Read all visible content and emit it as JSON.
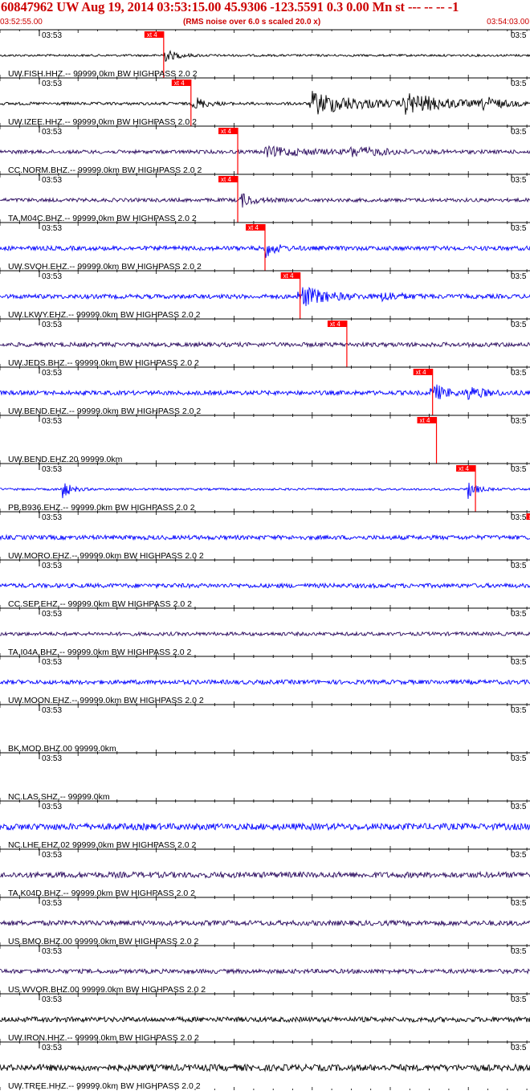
{
  "header": {
    "title": "60847962 UW Aug 19, 2014 03:53:15.00   45.9306 -123.5591  0.3 0.00 Mn st --- -- --  -1",
    "start_time": "03:52:55.00",
    "subtitle": "(RMS noise over 6.0 s scaled 20.0 x)",
    "end_time": "03:54:03.00"
  },
  "chart_data": {
    "type": "line",
    "x_unit": "time (UTC)",
    "xlim": [
      "03:52:55.00",
      "03:54:03.00"
    ],
    "grid": true,
    "minor_tick_label": "03:53",
    "end_tick_label": "03:5",
    "pick_label": "xt 4",
    "colors": {
      "pick": "#ff0000",
      "blue_trace": "#0000ff",
      "purple_trace": "#2a0a5e",
      "black_trace": "#000000",
      "header_text": "#cc0000"
    },
    "traces": [
      {
        "label": "UW.FISH.HHZ.-- 99999.0km BW  HIGHPASS  2.0  2",
        "color": "#000000",
        "pick_s": 21,
        "amp": 0.35,
        "events": [
          [
            21,
            0.9,
            1.5
          ]
        ],
        "noise": 0.15
      },
      {
        "label": "UW.IZEE.HHZ.-- 99999.0km BW  HIGHPASS  2.0  2",
        "color": "#000000",
        "pick_s": 24.5,
        "amp": 0.9,
        "events": [
          [
            25,
            1.0,
            1.2
          ],
          [
            40,
            1.6,
            6
          ],
          [
            52,
            1.3,
            5
          ],
          [
            62,
            0.8,
            2
          ]
        ],
        "noise": 0.2
      },
      {
        "label": "CC.NORM.BHZ.-- 99999.0km BW  HIGHPASS  2.0  2",
        "color": "#2a0a5e",
        "pick_s": 30.5,
        "amp": 0.35,
        "events": [
          [
            34,
            0.6,
            6
          ],
          [
            45,
            0.6,
            4
          ]
        ],
        "noise": 0.25
      },
      {
        "label": "TA.M04C.BHZ.-- 99999.0km BW  HIGHPASS  2.0  2",
        "color": "#2a0a5e",
        "pick_s": 30.5,
        "amp": 0.35,
        "events": [
          [
            31,
            0.9,
            1.5
          ]
        ],
        "noise": 0.25
      },
      {
        "label": "UW.SVOH.EHZ.-- 99999.0km BW  HIGHPASS  2.0  2",
        "color": "#0000ff",
        "pick_s": 34,
        "amp": 0.5,
        "events": [
          [
            34,
            1.2,
            1.2
          ]
        ],
        "noise": 0.3
      },
      {
        "label": "UW.LKWY.EHZ.-- 99999.0km BW  HIGHPASS  2.0  2",
        "color": "#0000ff",
        "pick_s": 38.5,
        "amp": 0.8,
        "events": [
          [
            38.5,
            1.5,
            3
          ],
          [
            49,
            0.6,
            2
          ]
        ],
        "noise": 0.3
      },
      {
        "label": "UW.JEDS.BHZ.-- 99999.0km BW  HIGHPASS  2.0  2",
        "color": "#2a0a5e",
        "pick_s": 44.5,
        "amp": 0.3,
        "events": [],
        "noise": 0.3
      },
      {
        "label": "UW.BEND.EHZ.-- 99999.0km BW  HIGHPASS  2.0  2",
        "color": "#0000ff",
        "pick_s": 55.5,
        "amp": 0.6,
        "events": [
          [
            55.5,
            1.3,
            1.5
          ],
          [
            60,
            0.8,
            2
          ],
          [
            73,
            0.7,
            1.5
          ]
        ],
        "noise": 0.3
      },
      {
        "label": "UW.BEND.EHZ.20 99999.0km",
        "color": "#0000ff",
        "pick_s": 56,
        "amp": 0,
        "events": [],
        "noise": 0
      },
      {
        "label": "PB.B936.EHZ.-- 99999.0km BW  HIGHPASS  2.0  2",
        "color": "#0000ff",
        "pick_s": 61,
        "amp": 0.25,
        "events": [
          [
            60,
            1.3,
            1
          ],
          [
            8,
            1.3,
            1
          ]
        ],
        "noise": 0.15
      },
      {
        "label": "UW.MORO.EHZ.-- 99999.0km BW  HIGHPASS  2.0  2",
        "color": "#0000ff",
        "pick_s": 70,
        "amp": 1.0,
        "events": [
          [
            70,
            1.2,
            2
          ],
          [
            103,
            1.8,
            12
          ]
        ],
        "noise": 0.3
      },
      {
        "label": "CC.SEP.EHZ.-- 99999.0km BW  HIGHPASS  2.0  2",
        "color": "#0000ff",
        "pick_s": 81.5,
        "amp": 0.6,
        "events": [
          [
            83,
            1.6,
            4
          ]
        ],
        "noise": 0.3
      },
      {
        "label": "TA.I04A.BHZ.-- 99999.0km BW  HIGHPASS  2.0  2",
        "color": "#2a0a5e",
        "pick_s": 84.5,
        "amp": 0.4,
        "events": [
          [
            84,
            0.8,
            2
          ],
          [
            107,
            0.6,
            2
          ]
        ],
        "noise": 0.25
      },
      {
        "label": "UW.MOON.EHZ.-- 99999.0km BW  HIGHPASS  2.0  2",
        "color": "#0000ff",
        "pick_s": 113,
        "amp": 0.45,
        "events": [
          [
            113,
            0.8,
            2
          ]
        ],
        "noise": 0.3
      },
      {
        "label": "BK.MOD.BHZ.00 99999.0km",
        "color": "#0000ff",
        "pick_s": null,
        "amp": 0,
        "events": [],
        "noise": 0
      },
      {
        "label": "NC.LAS.SHZ.-- 99999.0km",
        "color": "#0000ff",
        "pick_s": null,
        "amp": 0,
        "events": [],
        "noise": 0
      },
      {
        "label": "NC.LHE.EHZ.02 99999.0km BW  HIGHPASS  2.0  2",
        "color": "#0000ff",
        "pick_s": null,
        "amp": 0.55,
        "events": [],
        "noise": 0.45
      },
      {
        "label": "TA.K04D.BHZ.-- 99999.0km BW  HIGHPASS  2.0  2",
        "color": "#2a0a5e",
        "pick_s": null,
        "amp": 0.5,
        "events": [],
        "noise": 0.4
      },
      {
        "label": "US.BMO.BHZ.00 99999.0km BW  HIGHPASS  2.0  2",
        "color": "#2a0a5e",
        "pick_s": null,
        "amp": 0.4,
        "events": [],
        "noise": 0.35
      },
      {
        "label": "US.WVOR.BHZ.00 99999.0km BW  HIGHPASS  2.0  2",
        "color": "#2a0a5e",
        "pick_s": null,
        "amp": 0.35,
        "events": [],
        "noise": 0.3
      },
      {
        "label": "UW.IRON.HHZ.-- 99999.0km BW  HIGHPASS  2.0  2",
        "color": "#000000",
        "pick_s": null,
        "amp": 0.45,
        "events": [],
        "noise": 0.35
      },
      {
        "label": "UW.TREE.HHZ.-- 99999.0km BW  HIGHPASS  2.0  2",
        "color": "#000000",
        "pick_s": null,
        "amp": 0.55,
        "events": [],
        "noise": 0.45
      }
    ]
  }
}
